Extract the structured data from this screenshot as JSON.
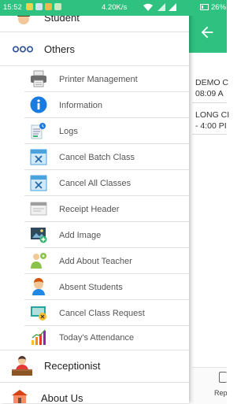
{
  "status_bar": {
    "time": "15:52",
    "network_speed": "4.20K/s",
    "battery": "26%"
  },
  "background": {
    "items": [
      {
        "line1": "DEMO C",
        "line2": "08:09 A"
      },
      {
        "line1": "LONG CI",
        "line2": "- 4:00 PI"
      }
    ],
    "bottom_label": "Rep"
  },
  "drawer": {
    "student_label": "Student",
    "others_label": "Others",
    "sub_items": [
      {
        "label": "Printer Management",
        "icon": "printer-icon"
      },
      {
        "label": "Information",
        "icon": "info-icon"
      },
      {
        "label": "Logs",
        "icon": "logs-icon"
      },
      {
        "label": "Cancel Batch Class",
        "icon": "cancel-calendar-icon"
      },
      {
        "label": "Cancel All Classes",
        "icon": "cancel-calendar-icon"
      },
      {
        "label": "Receipt Header",
        "icon": "receipt-icon"
      },
      {
        "label": "Add Image",
        "icon": "add-image-icon"
      },
      {
        "label": "Add About Teacher",
        "icon": "teacher-info-icon"
      },
      {
        "label": "Absent Students",
        "icon": "student-icon"
      },
      {
        "label": "Cancel Class Request",
        "icon": "cancel-request-icon"
      },
      {
        "label": "Today's Attendance",
        "icon": "attendance-chart-icon"
      }
    ],
    "receptionist_label": "Receptionist",
    "about_label": "About Us"
  },
  "colors": {
    "primary": "#2ec17f",
    "info_blue": "#1a7be0",
    "others_icon": "#2a4f9a"
  }
}
